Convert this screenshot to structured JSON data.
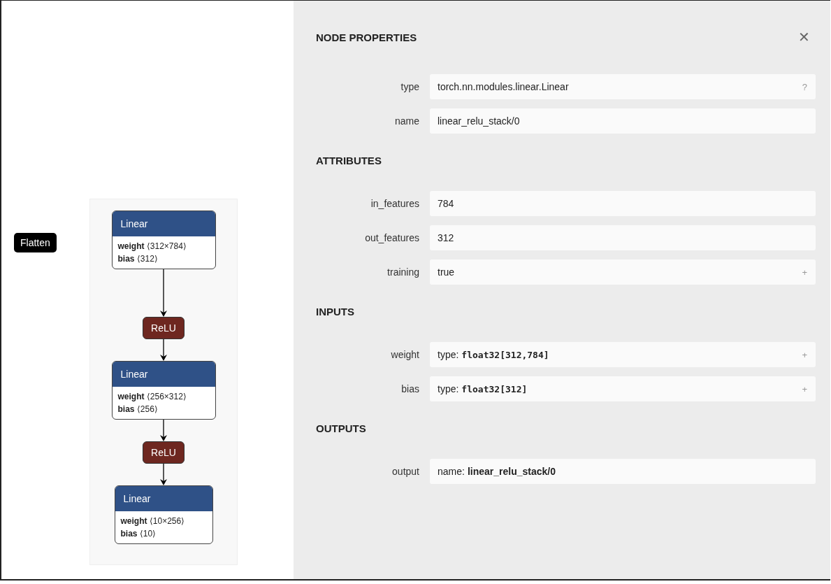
{
  "graph": {
    "loose_nodes": [
      {
        "title": "Flatten"
      }
    ],
    "nodes": [
      {
        "kind": "linear",
        "title": "Linear",
        "attributes": [
          {
            "name": "weight",
            "value": "⟨312×784⟩"
          },
          {
            "name": "bias",
            "value": "⟨312⟩"
          }
        ]
      },
      {
        "kind": "relu",
        "title": "ReLU"
      },
      {
        "kind": "linear",
        "title": "Linear",
        "attributes": [
          {
            "name": "weight",
            "value": "⟨256×312⟩"
          },
          {
            "name": "bias",
            "value": "⟨256⟩"
          }
        ]
      },
      {
        "kind": "relu",
        "title": "ReLU"
      },
      {
        "kind": "linear",
        "title": "Linear",
        "attributes": [
          {
            "name": "weight",
            "value": "⟨10×256⟩"
          },
          {
            "name": "bias",
            "value": "⟨10⟩"
          }
        ]
      }
    ]
  },
  "panel": {
    "title": "NODE PROPERTIES",
    "close": "✕",
    "sections": [
      {
        "rows": [
          {
            "label": "type",
            "value": "torch.nn.modules.linear.Linear",
            "action": "?"
          },
          {
            "label": "name",
            "value": "linear_relu_stack/0"
          }
        ]
      },
      {
        "heading": "ATTRIBUTES",
        "rows": [
          {
            "label": "in_features",
            "value": "784"
          },
          {
            "label": "out_features",
            "value": "312"
          },
          {
            "label": "training",
            "value": "true",
            "action": "+"
          }
        ]
      },
      {
        "heading": "INPUTS",
        "rows": [
          {
            "label": "weight",
            "prefix": "type:",
            "value": "float32[312,784]",
            "kind": "type",
            "action": "+"
          },
          {
            "label": "bias",
            "prefix": "type:",
            "value": "float32[312]",
            "kind": "type",
            "action": "+"
          }
        ]
      },
      {
        "heading": "OUTPUTS",
        "rows": [
          {
            "label": "output",
            "prefix": "name:",
            "value": "linear_relu_stack/0",
            "kind": "name"
          }
        ]
      }
    ]
  }
}
